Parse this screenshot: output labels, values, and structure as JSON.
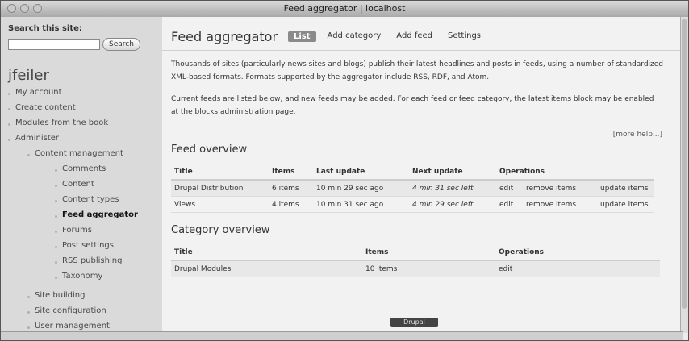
{
  "window": {
    "title": "Feed aggregator | localhost"
  },
  "sidebar": {
    "search_title": "Search this site:",
    "search_value": "",
    "search_button": "Search",
    "user_name": "jfeiler",
    "nav": [
      {
        "label": "My account"
      },
      {
        "label": "Create content"
      },
      {
        "label": "Modules from the book"
      },
      {
        "label": "Administer"
      },
      {
        "label": "Content management"
      },
      {
        "label": "Comments"
      },
      {
        "label": "Content"
      },
      {
        "label": "Content types"
      },
      {
        "label": "Feed aggregator"
      },
      {
        "label": "Forums"
      },
      {
        "label": "Post settings"
      },
      {
        "label": "RSS publishing"
      },
      {
        "label": "Taxonomy"
      },
      {
        "label": "Site building"
      },
      {
        "label": "Site configuration"
      },
      {
        "label": "User management"
      }
    ]
  },
  "main": {
    "page_title": "Feed aggregator",
    "tabs": [
      "List",
      "Add category",
      "Add feed",
      "Settings"
    ],
    "intro": "Thousands of sites (particularly news sites and blogs) publish their latest headlines and posts in feeds, using a number of standardized XML-based formats. Formats supported by the aggregator include RSS, RDF, and Atom.",
    "intro2": "Current feeds are listed below, and new feeds may be added. For each feed or feed category, the latest items block may be enabled at the blocks administration page.",
    "more_help": "[more help...]",
    "feed_overview": {
      "title": "Feed overview",
      "headers": [
        "Title",
        "Items",
        "Last update",
        "Next update",
        "Operations"
      ],
      "rows": [
        {
          "title": "Drupal Distribution",
          "items": "6 items",
          "last": "10 min 29 sec ago",
          "next": "4 min 31 sec left",
          "op1": "edit",
          "op2": "remove items",
          "op3": "update items"
        },
        {
          "title": "Views",
          "items": "4 items",
          "last": "10 min 31 sec ago",
          "next": "4 min 29 sec left",
          "op1": "edit",
          "op2": "remove items",
          "op3": "update items"
        }
      ]
    },
    "category_overview": {
      "title": "Category overview",
      "headers": [
        "Title",
        "Items",
        "Operations"
      ],
      "rows": [
        {
          "title": "Drupal Modules",
          "items": "10 items",
          "op": "edit"
        }
      ]
    },
    "footer_badge": "Drupal"
  }
}
